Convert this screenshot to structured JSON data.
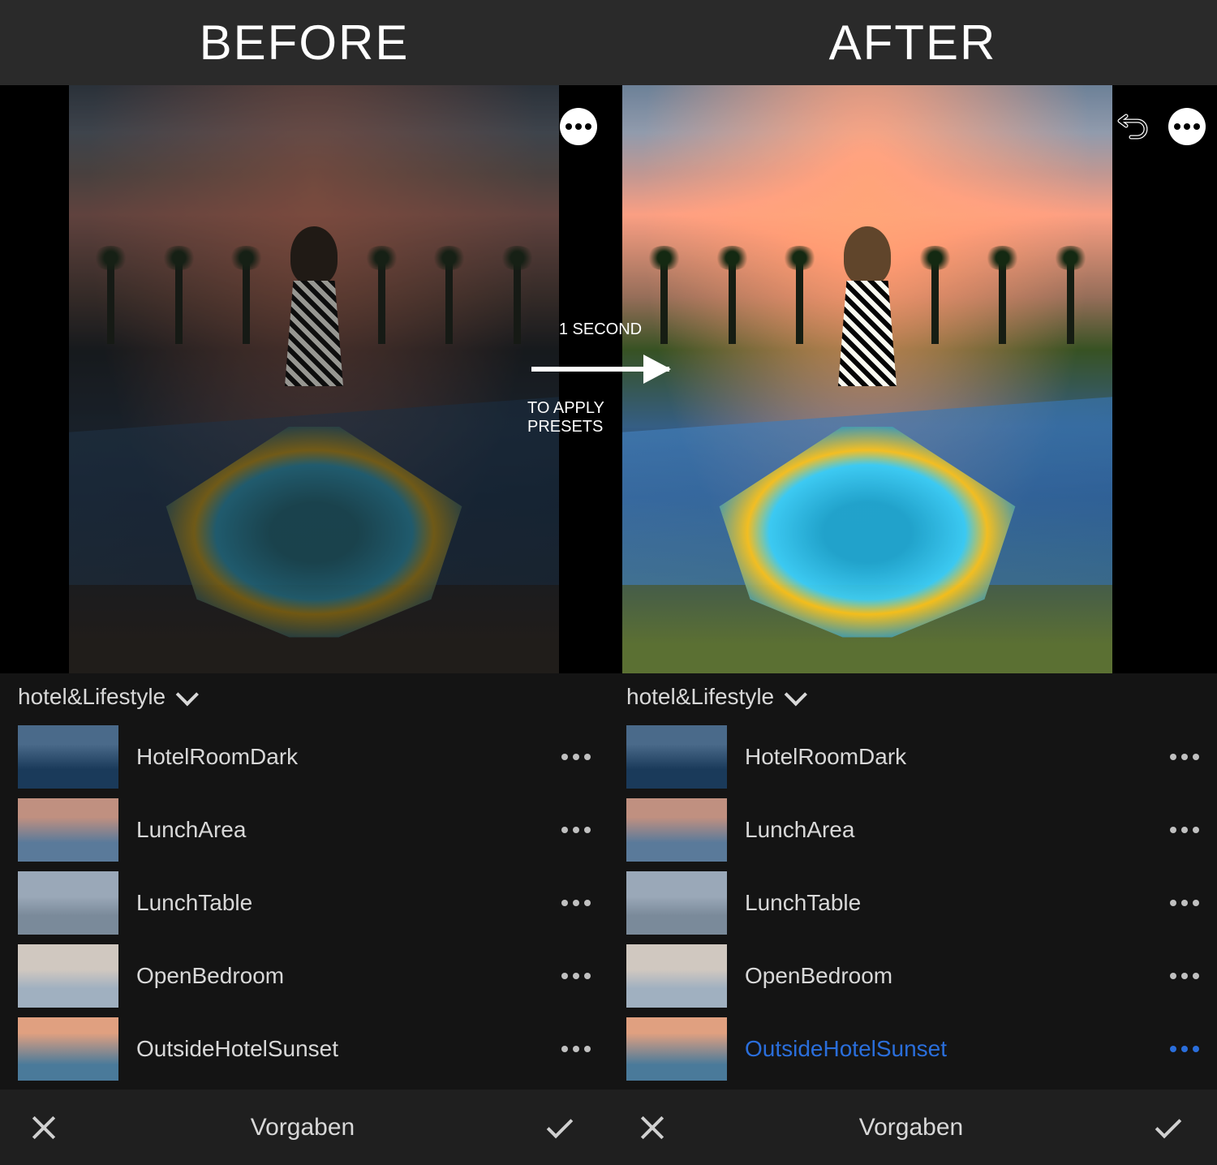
{
  "header": {
    "before": "BEFORE",
    "after": "AFTER"
  },
  "overlay": {
    "line1": "1 SECOND",
    "line2": "TO APPLY PRESETS"
  },
  "category": "hotel&Lifestyle",
  "presets": [
    {
      "name": "HotelRoomDark"
    },
    {
      "name": "LunchArea"
    },
    {
      "name": "LunchTable"
    },
    {
      "name": "OpenBedroom"
    },
    {
      "name": "OutsideHotelSunset"
    }
  ],
  "selected_preset_after": "OutsideHotelSunset",
  "bottom_bar_title": "Vorgaben"
}
